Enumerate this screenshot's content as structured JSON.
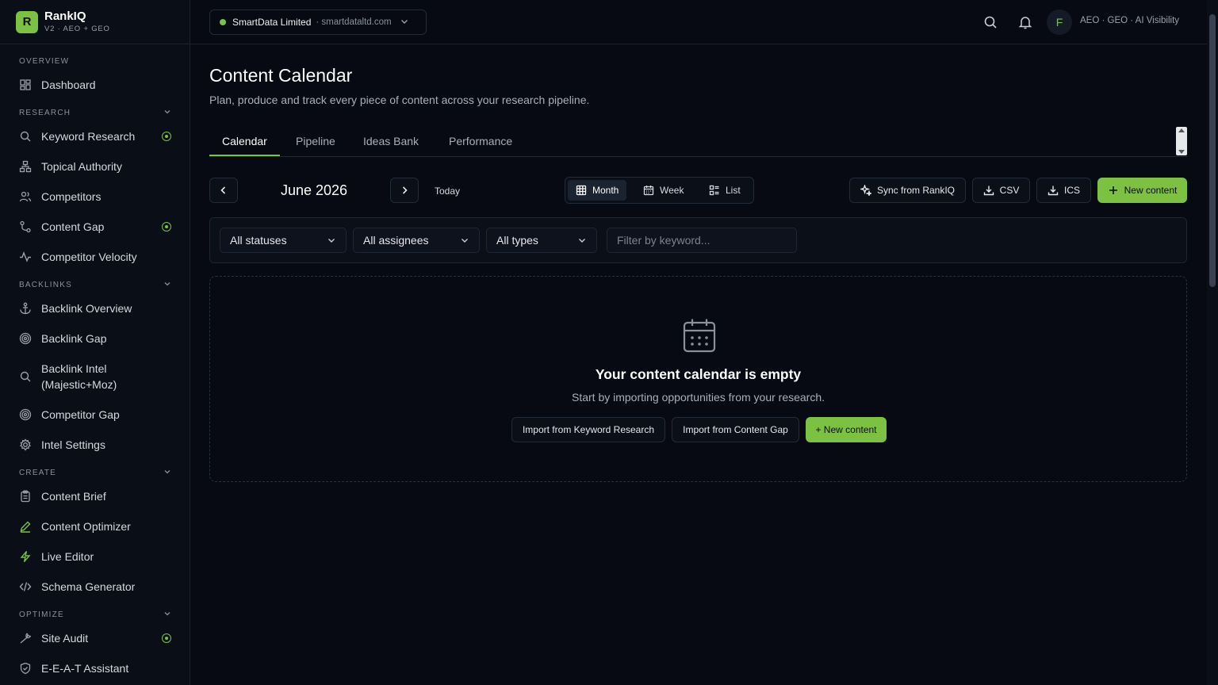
{
  "brand": {
    "logo_letter": "R",
    "name": "RankIQ",
    "subtitle": "V2 · AEO + GEO"
  },
  "sidebar": {
    "sections": [
      {
        "label": "OVERVIEW",
        "collapsible": false
      },
      {
        "label": "RESEARCH",
        "collapsible": true
      },
      {
        "label": "BACKLINKS",
        "collapsible": true
      },
      {
        "label": "CREATE",
        "collapsible": true
      },
      {
        "label": "OPTIMIZE",
        "collapsible": true
      }
    ],
    "items": [
      {
        "label": "Dashboard",
        "icon": "dashboard-grid-icon"
      },
      {
        "label": "Keyword Research",
        "icon": "search-icon",
        "badge": true
      },
      {
        "label": "Topical Authority",
        "icon": "hierarchy-icon"
      },
      {
        "label": "Competitors",
        "icon": "users-icon"
      },
      {
        "label": "Content Gap",
        "icon": "route-icon",
        "badge": true
      },
      {
        "label": "Competitor Velocity",
        "icon": "activity-icon"
      },
      {
        "label": "Backlink Overview",
        "icon": "anchor-icon"
      },
      {
        "label": "Backlink Gap",
        "icon": "target-icon"
      },
      {
        "label": "Backlink Intel\n(Majestic+Moz)",
        "line1": "Backlink Intel",
        "line2": "(Majestic+Moz)",
        "icon": "search-icon"
      },
      {
        "label": "Competitor Gap",
        "icon": "target-icon"
      },
      {
        "label": "Intel Settings",
        "icon": "gear-icon"
      },
      {
        "label": "Content Brief",
        "icon": "clipboard-icon"
      },
      {
        "label": "Content Optimizer",
        "icon": "pen-icon"
      },
      {
        "label": "Live Editor",
        "icon": "lightning-icon"
      },
      {
        "label": "Schema Generator",
        "icon": "code-icon"
      },
      {
        "label": "Site Audit",
        "icon": "wrench-icon",
        "badge": true
      },
      {
        "label": "E-E-A-T Assistant",
        "icon": "shield-icon"
      }
    ]
  },
  "topbar": {
    "org_name": "SmartData Limited",
    "org_domain": "· smartdataltd.com",
    "user_initial": "F",
    "tagline": "AEO · GEO · AI Visibility"
  },
  "page": {
    "title": "Content Calendar",
    "subtitle": "Plan, produce and track every piece of content across your research pipeline.",
    "tabs": [
      "Calendar",
      "Pipeline",
      "Ideas Bank",
      "Performance"
    ],
    "active_tab": "Calendar"
  },
  "toolbar": {
    "month_label": "June 2026",
    "today_label": "Today",
    "views": [
      "Month",
      "Week",
      "List"
    ],
    "active_view": "Month",
    "sync_label": "Sync from RankIQ",
    "csv_label": "CSV",
    "ics_label": "ICS",
    "new_content_label": "New content"
  },
  "filters": {
    "status": "All statuses",
    "assignee": "All assignees",
    "type": "All types",
    "keyword_placeholder": "Filter by keyword..."
  },
  "empty_state": {
    "title": "Your content calendar is empty",
    "subtitle": "Start by importing opportunities from your research.",
    "import_keyword_label": "Import from Keyword Research",
    "import_gap_label": "Import from Content Gap",
    "new_content_label": "+ New content"
  },
  "colors": {
    "accent": "#7cc142",
    "background": "#070a12",
    "sidebar": "#0a0e17"
  }
}
